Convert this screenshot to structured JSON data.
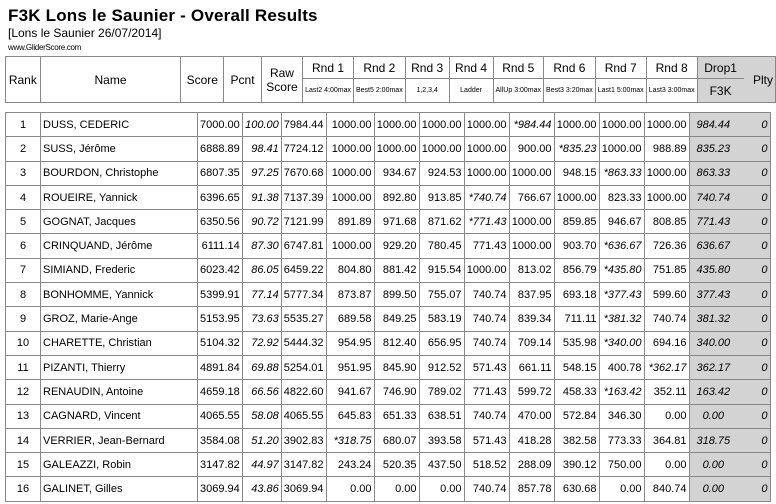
{
  "title": "F3K Lons le Saunier - Overall Results",
  "subtitle": "[Lons le Saunier 26/07/2014]",
  "site": "www.GliderScore.com",
  "headers": {
    "rank": "Rank",
    "name": "Name",
    "score": "Score",
    "pcnt": "Pcnt",
    "raw": "Raw Score",
    "drop": "Drop1",
    "drop_sub": "F3K",
    "plty": "Plty",
    "rounds": [
      {
        "label": "Rnd 1",
        "task": "Last2 4:00max"
      },
      {
        "label": "Rnd 2",
        "task": "Best5 2:00max"
      },
      {
        "label": "Rnd 3",
        "task": "1,2,3,4"
      },
      {
        "label": "Rnd 4",
        "task": "Ladder"
      },
      {
        "label": "Rnd 5",
        "task": "AllUp 3:00max"
      },
      {
        "label": "Rnd 6",
        "task": "Best3 3:20max"
      },
      {
        "label": "Rnd 7",
        "task": "Last1 5:00max"
      },
      {
        "label": "Rnd 8",
        "task": "Last3 3:00max"
      }
    ]
  },
  "colors": {
    "drop_column_bg": "#d3d3d3",
    "grid": "#888888"
  },
  "rows": [
    {
      "rank": "1",
      "name": "DUSS, CEDERIC",
      "score": "7000.00",
      "pcnt": "100.00",
      "raw": "7984.44",
      "r": [
        "1000.00",
        "1000.00",
        "1000.00",
        "1000.00",
        "*984.44",
        "1000.00",
        "1000.00",
        "1000.00"
      ],
      "drop": "984.44",
      "plty": "0"
    },
    {
      "rank": "2",
      "name": "SUSS, Jérôme",
      "score": "6888.89",
      "pcnt": "98.41",
      "raw": "7724.12",
      "r": [
        "1000.00",
        "1000.00",
        "1000.00",
        "1000.00",
        "900.00",
        "*835.23",
        "1000.00",
        "988.89"
      ],
      "drop": "835.23",
      "plty": "0"
    },
    {
      "rank": "3",
      "name": "BOURDON, Christophe",
      "score": "6807.35",
      "pcnt": "97.25",
      "raw": "7670.68",
      "r": [
        "1000.00",
        "934.67",
        "924.53",
        "1000.00",
        "1000.00",
        "948.15",
        "*863.33",
        "1000.00"
      ],
      "drop": "863.33",
      "plty": "0"
    },
    {
      "rank": "4",
      "name": "ROUEIRE, Yannick",
      "score": "6396.65",
      "pcnt": "91.38",
      "raw": "7137.39",
      "r": [
        "1000.00",
        "892.80",
        "913.85",
        "*740.74",
        "766.67",
        "1000.00",
        "823.33",
        "1000.00"
      ],
      "drop": "740.74",
      "plty": "0"
    },
    {
      "rank": "5",
      "name": "GOGNAT, Jacques",
      "score": "6350.56",
      "pcnt": "90.72",
      "raw": "7121.99",
      "r": [
        "891.89",
        "971.68",
        "871.62",
        "*771.43",
        "1000.00",
        "859.85",
        "946.67",
        "808.85"
      ],
      "drop": "771.43",
      "plty": "0"
    },
    {
      "rank": "6",
      "name": "CRINQUAND, Jérôme",
      "score": "6111.14",
      "pcnt": "87.30",
      "raw": "6747.81",
      "r": [
        "1000.00",
        "929.20",
        "780.45",
        "771.43",
        "1000.00",
        "903.70",
        "*636.67",
        "726.36"
      ],
      "drop": "636.67",
      "plty": "0"
    },
    {
      "rank": "7",
      "name": "SIMIAND, Frederic",
      "score": "6023.42",
      "pcnt": "86.05",
      "raw": "6459.22",
      "r": [
        "804.80",
        "881.42",
        "915.54",
        "1000.00",
        "813.02",
        "856.79",
        "*435.80",
        "751.85"
      ],
      "drop": "435.80",
      "plty": "0"
    },
    {
      "rank": "8",
      "name": "BONHOMME, Yannick",
      "score": "5399.91",
      "pcnt": "77.14",
      "raw": "5777.34",
      "r": [
        "873.87",
        "899.50",
        "755.07",
        "740.74",
        "837.95",
        "693.18",
        "*377.43",
        "599.60"
      ],
      "drop": "377.43",
      "plty": "0"
    },
    {
      "rank": "9",
      "name": "GROZ, Marie-Ange",
      "score": "5153.95",
      "pcnt": "73.63",
      "raw": "5535.27",
      "r": [
        "689.58",
        "849.25",
        "583.19",
        "740.74",
        "839.34",
        "711.11",
        "*381.32",
        "740.74"
      ],
      "drop": "381.32",
      "plty": "0"
    },
    {
      "rank": "10",
      "name": "CHARETTE, Christian",
      "score": "5104.32",
      "pcnt": "72.92",
      "raw": "5444.32",
      "r": [
        "954.95",
        "812.40",
        "656.95",
        "740.74",
        "709.14",
        "535.98",
        "*340.00",
        "694.16"
      ],
      "drop": "340.00",
      "plty": "0"
    },
    {
      "rank": "11",
      "name": "PIZANTI, Thierry",
      "score": "4891.84",
      "pcnt": "69.88",
      "raw": "5254.01",
      "r": [
        "951.95",
        "845.90",
        "912.52",
        "571.43",
        "661.11",
        "548.15",
        "400.78",
        "*362.17"
      ],
      "drop": "362.17",
      "plty": "0"
    },
    {
      "rank": "12",
      "name": "RENAUDIN, Antoine",
      "score": "4659.18",
      "pcnt": "66.56",
      "raw": "4822.60",
      "r": [
        "941.67",
        "746.90",
        "789.02",
        "771.43",
        "599.72",
        "458.33",
        "*163.42",
        "352.11"
      ],
      "drop": "163.42",
      "plty": "0"
    },
    {
      "rank": "13",
      "name": "CAGNARD, Vincent",
      "score": "4065.55",
      "pcnt": "58.08",
      "raw": "4065.55",
      "r": [
        "645.83",
        "651.33",
        "638.51",
        "740.74",
        "470.00",
        "572.84",
        "346.30",
        "0.00"
      ],
      "drop": "0.00",
      "plty": "0"
    },
    {
      "rank": "14",
      "name": "VERRIER, Jean-Bernard",
      "score": "3584.08",
      "pcnt": "51.20",
      "raw": "3902.83",
      "r": [
        "*318.75",
        "680.07",
        "393.58",
        "571.43",
        "418.28",
        "382.58",
        "773.33",
        "364.81"
      ],
      "drop": "318.75",
      "plty": "0"
    },
    {
      "rank": "15",
      "name": "GALEAZZI, Robin",
      "score": "3147.82",
      "pcnt": "44.97",
      "raw": "3147.82",
      "r": [
        "243.24",
        "520.35",
        "437.50",
        "518.52",
        "288.09",
        "390.12",
        "750.00",
        "0.00"
      ],
      "drop": "0.00",
      "plty": "0"
    },
    {
      "rank": "16",
      "name": "GALINET, Gilles",
      "score": "3069.94",
      "pcnt": "43.86",
      "raw": "3069.94",
      "r": [
        "0.00",
        "0.00",
        "0.00",
        "740.74",
        "857.78",
        "630.68",
        "0.00",
        "840.74"
      ],
      "drop": "0.00",
      "plty": "0"
    }
  ]
}
